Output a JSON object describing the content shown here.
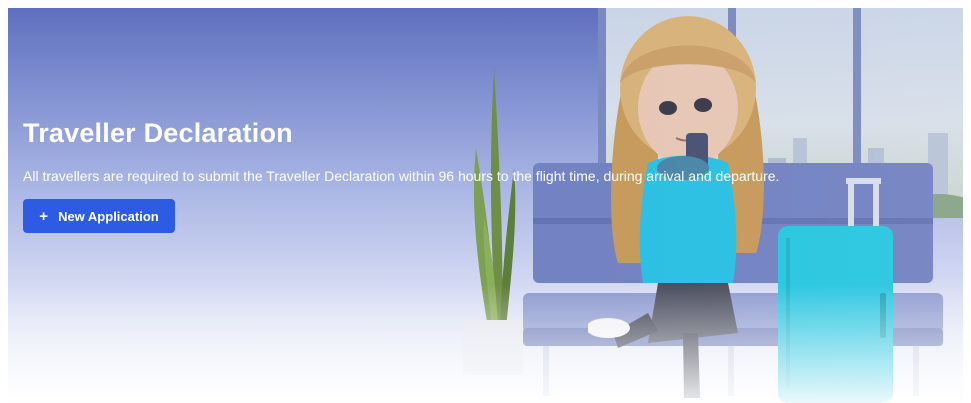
{
  "hero": {
    "title": "Traveller Declaration",
    "subtitle": "All travellers are required to submit the Traveller Declaration within 96 hours to the flight time, during arrival and departure.",
    "new_application": {
      "icon": "plus-icon",
      "icon_glyph": "+",
      "label": "New Application"
    }
  },
  "illustration": {
    "description_icon": "traveller-illustration"
  },
  "colors": {
    "accent": "#2d5be3",
    "hero_top": "#5f6fbf",
    "hero_bottom": "#f6f7fc",
    "suitcase": "#29c6e0",
    "shirt": "#2bc0e4"
  }
}
